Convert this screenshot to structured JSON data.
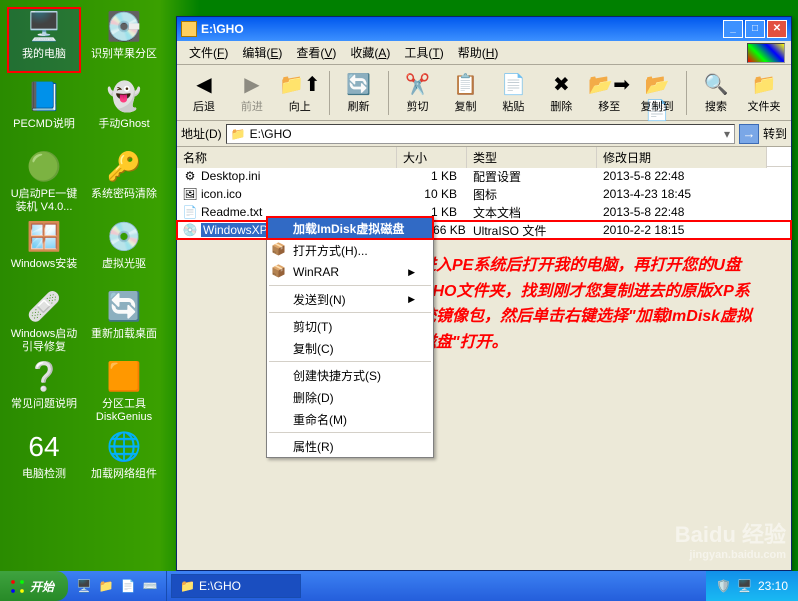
{
  "desktop_icons": [
    {
      "label": "我的电脑",
      "glyph": "🖥️",
      "sel": true
    },
    {
      "label": "识别苹果分区",
      "glyph": "💽"
    },
    {
      "label": "PECMD说明",
      "glyph": "📘"
    },
    {
      "label": "手动Ghost",
      "glyph": "👻"
    },
    {
      "label": "U启动PE一键装机 V4.0...",
      "glyph": "🟢"
    },
    {
      "label": "系统密码清除",
      "glyph": "🔑"
    },
    {
      "label": "Windows安装",
      "glyph": "🪟"
    },
    {
      "label": "虚拟光驱",
      "glyph": "💿"
    },
    {
      "label": "Windows启动引导修复",
      "glyph": "🩹"
    },
    {
      "label": "重新加载桌面",
      "glyph": "🔄"
    },
    {
      "label": "常见问题说明",
      "glyph": "❔"
    },
    {
      "label": "分区工具DiskGenius",
      "glyph": "🟧"
    },
    {
      "label": "电脑检测",
      "glyph": "64"
    },
    {
      "label": "加载网络组件",
      "glyph": "🌐"
    }
  ],
  "window": {
    "title": "E:\\GHO",
    "menus": [
      {
        "t": "文件",
        "u": "F"
      },
      {
        "t": "编辑",
        "u": "E"
      },
      {
        "t": "查看",
        "u": "V"
      },
      {
        "t": "收藏",
        "u": "A"
      },
      {
        "t": "工具",
        "u": "T"
      },
      {
        "t": "帮助",
        "u": "H"
      }
    ],
    "toolbar": [
      {
        "label": "后退",
        "glyph": "◀",
        "dis": false
      },
      {
        "label": "前进",
        "glyph": "▶",
        "dis": true
      },
      {
        "label": "向上",
        "glyph": "📁⬆",
        "dis": false
      },
      {
        "sep": true
      },
      {
        "label": "刷新",
        "glyph": "🔄",
        "dis": false
      },
      {
        "sep": true
      },
      {
        "label": "剪切",
        "glyph": "✂️",
        "dis": false
      },
      {
        "label": "复制",
        "glyph": "📋",
        "dis": false
      },
      {
        "label": "粘贴",
        "glyph": "📄",
        "dis": false
      },
      {
        "label": "删除",
        "glyph": "✖",
        "dis": false
      },
      {
        "label": "移至",
        "glyph": "📂➡",
        "dis": false
      },
      {
        "label": "复制到",
        "glyph": "📂📄",
        "dis": false
      },
      {
        "sep": true
      },
      {
        "label": "搜索",
        "glyph": "🔍",
        "dis": false
      },
      {
        "label": "文件夹",
        "glyph": "📁",
        "dis": false
      }
    ],
    "address_label": "地址(D)",
    "address_value": "E:\\GHO",
    "go_label": "转到",
    "columns": [
      "名称",
      "大小",
      "类型",
      "修改日期"
    ],
    "files": [
      {
        "name": "Desktop.ini",
        "size": "1 KB",
        "type": "配置设置",
        "date": "2013-5-8 22:48",
        "ic": "⚙"
      },
      {
        "name": "icon.ico",
        "size": "10 KB",
        "type": "图标",
        "date": "2013-4-23 18:45",
        "ic": "🖼"
      },
      {
        "name": "Readme.txt",
        "size": "1 KB",
        "type": "文本文档",
        "date": "2013-5-8 22:48",
        "ic": "📄"
      },
      {
        "name": "WindowsXP.iso",
        "size": "615,466 KB",
        "type": "UltraISO 文件",
        "date": "2010-2-2 18:15",
        "ic": "💿",
        "sel": true
      }
    ]
  },
  "context_menu": [
    {
      "label": "加载ImDisk虚拟磁盘",
      "hl": true
    },
    {
      "label": "打开方式(H)...",
      "icon": true
    },
    {
      "label": "WinRAR",
      "arrow": true,
      "icon": true
    },
    {
      "sep": true
    },
    {
      "label": "发送到(N)",
      "arrow": true
    },
    {
      "sep": true
    },
    {
      "label": "剪切(T)"
    },
    {
      "label": "复制(C)"
    },
    {
      "sep": true
    },
    {
      "label": "创建快捷方式(S)"
    },
    {
      "label": "删除(D)"
    },
    {
      "label": "重命名(M)"
    },
    {
      "sep": true
    },
    {
      "label": "属性(R)"
    }
  ],
  "annotation": "进入PE系统后打开我的电脑，再打开您的U盘GHO文件夹，找到刚才您复制进去的原版XP系统镜像包，然后单击右键选择\"加载ImDisk虚拟磁盘\"打开。",
  "watermark": {
    "brand": "Baidu 经验",
    "url": "jingyan.baidu.com"
  },
  "taskbar": {
    "start": "开始",
    "task_items": [
      {
        "label": "E:\\GHO",
        "active": true
      }
    ],
    "clock": "23:10"
  }
}
